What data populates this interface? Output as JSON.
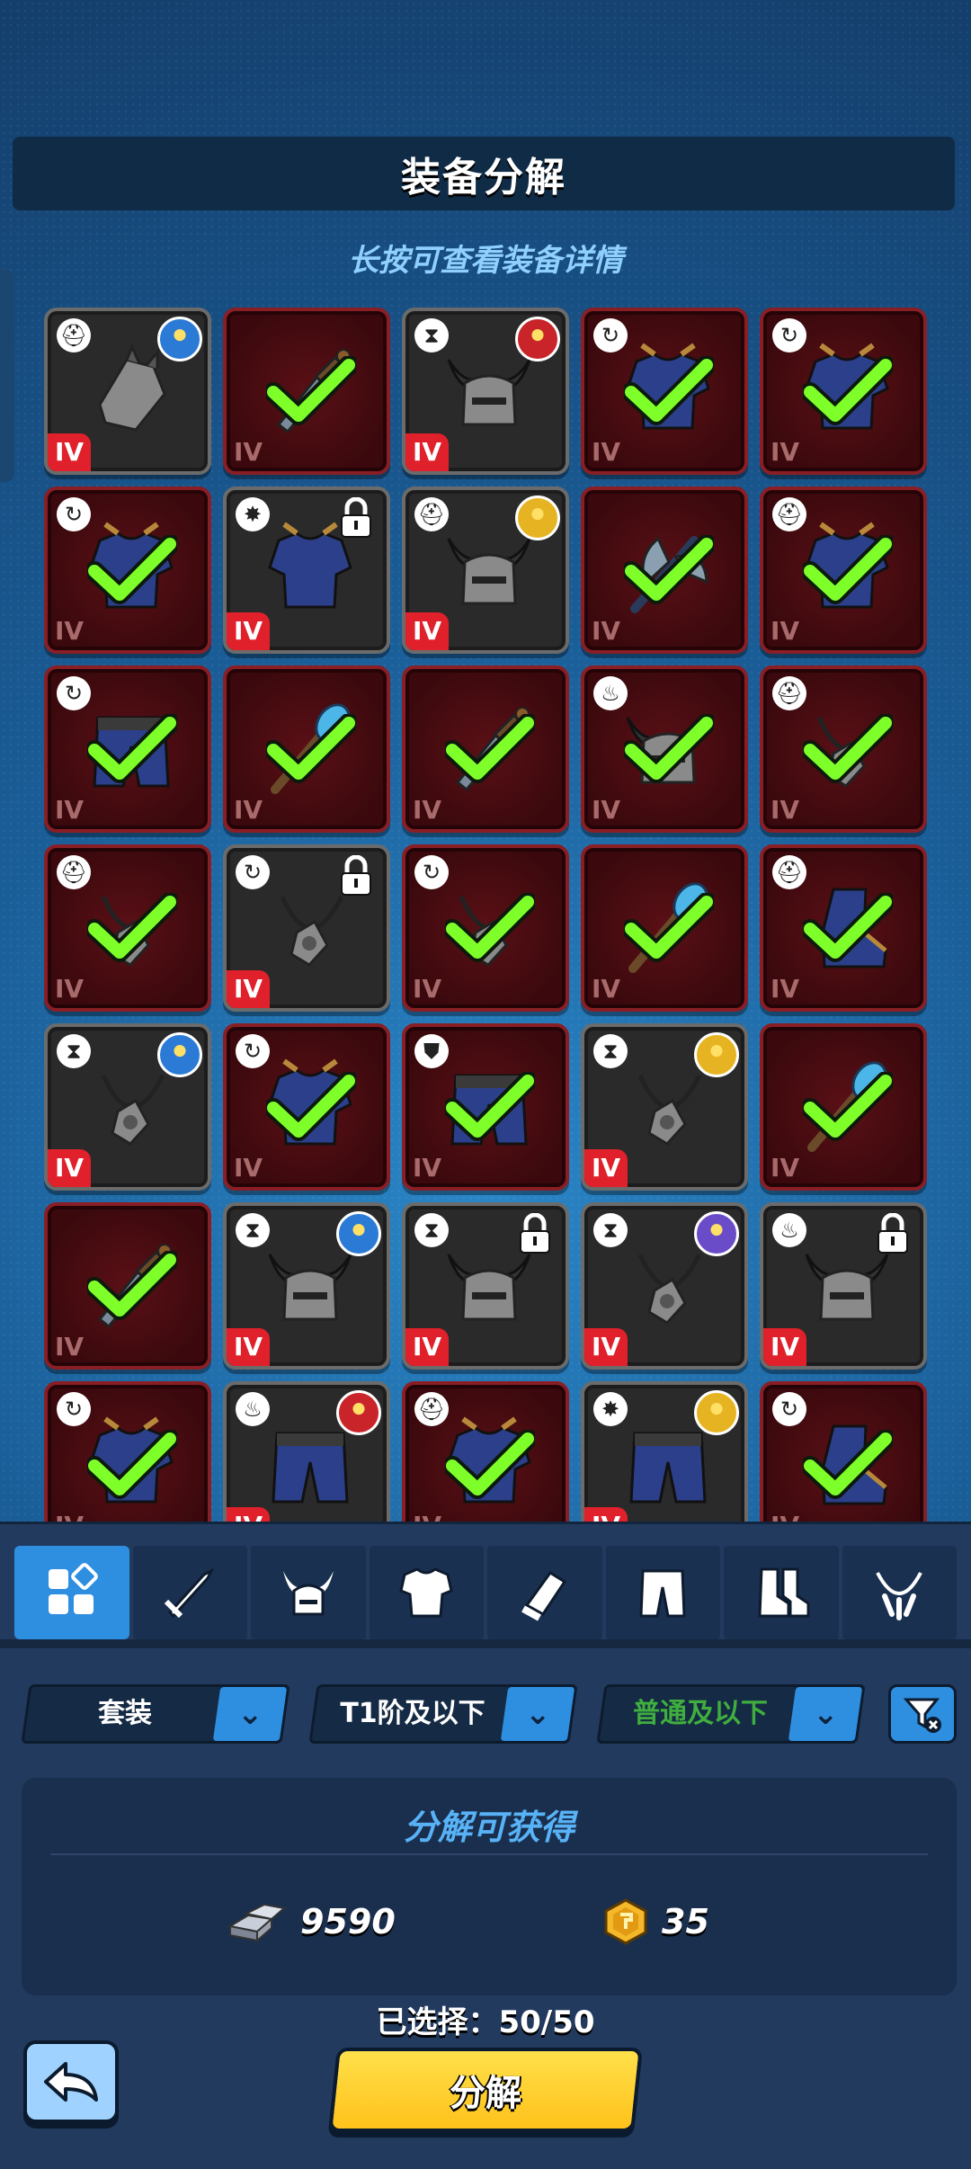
{
  "header": {
    "title": "装备分解",
    "hint": "长按可查看装备详情"
  },
  "colors": {
    "accent": "#2e8fe0",
    "selected_bg": "#3b090d",
    "check": "#7fff2a",
    "tier_red": "#e0202a",
    "button_yellow": "#ffd02a"
  },
  "grid": {
    "items": [
      {
        "item": "gauntlet",
        "set": "helmet-mark",
        "selected": false,
        "locked": false,
        "hero": "blue-hero-portrait",
        "tier": "IV"
      },
      {
        "item": "dagger",
        "set": "",
        "selected": true,
        "locked": false,
        "hero": "",
        "tier": "IV"
      },
      {
        "item": "horned-helmet",
        "set": "hourglass",
        "selected": false,
        "locked": false,
        "hero": "red-hero-portrait",
        "tier": "IV"
      },
      {
        "item": "chest-armor",
        "set": "cycle",
        "selected": true,
        "locked": false,
        "hero": "",
        "tier": "IV"
      },
      {
        "item": "chest-armor",
        "set": "cycle",
        "selected": true,
        "locked": false,
        "hero": "",
        "tier": "IV"
      },
      {
        "item": "chest-armor",
        "set": "cycle",
        "selected": true,
        "locked": false,
        "hero": "",
        "tier": "IV"
      },
      {
        "item": "chest-armor",
        "set": "star-burst",
        "selected": false,
        "locked": true,
        "hero": "",
        "tier": "IV"
      },
      {
        "item": "horned-helmet",
        "set": "helmet-mark",
        "selected": false,
        "locked": false,
        "hero": "gold-hero-portrait",
        "tier": "IV"
      },
      {
        "item": "axe",
        "set": "",
        "selected": true,
        "locked": false,
        "hero": "",
        "tier": "IV"
      },
      {
        "item": "chest-armor",
        "set": "helmet-mark",
        "selected": true,
        "locked": false,
        "hero": "",
        "tier": "IV"
      },
      {
        "item": "leg-armor",
        "set": "cycle",
        "selected": true,
        "locked": false,
        "hero": "",
        "tier": "IV"
      },
      {
        "item": "staff",
        "set": "",
        "selected": true,
        "locked": false,
        "hero": "",
        "tier": "IV"
      },
      {
        "item": "dagger",
        "set": "",
        "selected": true,
        "locked": false,
        "hero": "",
        "tier": "IV"
      },
      {
        "item": "horned-helmet",
        "set": "flame",
        "selected": true,
        "locked": false,
        "hero": "",
        "tier": "IV"
      },
      {
        "item": "amulet",
        "set": "helmet-mark",
        "selected": true,
        "locked": false,
        "hero": "",
        "tier": "IV"
      },
      {
        "item": "amulet",
        "set": "helmet-mark",
        "selected": true,
        "locked": false,
        "hero": "",
        "tier": "IV"
      },
      {
        "item": "amulet",
        "set": "cycle",
        "selected": false,
        "locked": true,
        "hero": "",
        "tier": "IV"
      },
      {
        "item": "amulet",
        "set": "cycle",
        "selected": true,
        "locked": false,
        "hero": "",
        "tier": "IV"
      },
      {
        "item": "staff",
        "set": "",
        "selected": true,
        "locked": false,
        "hero": "",
        "tier": "IV"
      },
      {
        "item": "boots",
        "set": "helmet-mark",
        "selected": true,
        "locked": false,
        "hero": "",
        "tier": "IV"
      },
      {
        "item": "amulet",
        "set": "hourglass",
        "selected": false,
        "locked": false,
        "hero": "blue-hero-portrait",
        "tier": "IV"
      },
      {
        "item": "chest-armor",
        "set": "cycle",
        "selected": true,
        "locked": false,
        "hero": "",
        "tier": "IV"
      },
      {
        "item": "leg-armor",
        "set": "shield",
        "selected": true,
        "locked": false,
        "hero": "",
        "tier": "IV"
      },
      {
        "item": "amulet",
        "set": "hourglass",
        "selected": false,
        "locked": false,
        "hero": "gold-hero-portrait",
        "tier": "IV"
      },
      {
        "item": "staff",
        "set": "",
        "selected": true,
        "locked": false,
        "hero": "",
        "tier": "IV"
      },
      {
        "item": "dagger",
        "set": "",
        "selected": true,
        "locked": false,
        "hero": "",
        "tier": "IV"
      },
      {
        "item": "horned-helmet",
        "set": "hourglass",
        "selected": false,
        "locked": false,
        "hero": "blue-hero-portrait",
        "tier": "IV"
      },
      {
        "item": "horned-helmet",
        "set": "hourglass",
        "selected": false,
        "locked": true,
        "hero": "",
        "tier": "IV"
      },
      {
        "item": "amulet",
        "set": "hourglass",
        "selected": false,
        "locked": false,
        "hero": "purple-hero-portrait",
        "tier": "IV"
      },
      {
        "item": "horned-helmet",
        "set": "flame",
        "selected": false,
        "locked": true,
        "hero": "",
        "tier": "IV"
      },
      {
        "item": "chest-armor",
        "set": "cycle",
        "selected": true,
        "locked": false,
        "hero": "",
        "tier": "IV"
      },
      {
        "item": "leg-armor",
        "set": "flame",
        "selected": false,
        "locked": false,
        "hero": "red-hero-portrait",
        "tier": "IV"
      },
      {
        "item": "chest-armor",
        "set": "helmet-mark",
        "selected": true,
        "locked": false,
        "hero": "",
        "tier": "IV"
      },
      {
        "item": "leg-armor",
        "set": "star-burst",
        "selected": false,
        "locked": false,
        "hero": "gold-hero-portrait",
        "tier": "IV"
      },
      {
        "item": "boots",
        "set": "cycle",
        "selected": true,
        "locked": false,
        "hero": "",
        "tier": "IV"
      }
    ]
  },
  "category_tabs": [
    {
      "icon": "grid-all-icon",
      "active": true
    },
    {
      "icon": "sword-icon",
      "active": false
    },
    {
      "icon": "helmet-icon",
      "active": false
    },
    {
      "icon": "chest-icon",
      "active": false
    },
    {
      "icon": "bracer-icon",
      "active": false
    },
    {
      "icon": "pants-icon",
      "active": false
    },
    {
      "icon": "boots-icon",
      "active": false
    },
    {
      "icon": "amulet-icon",
      "active": false
    }
  ],
  "filters": {
    "set": {
      "label": "套装"
    },
    "tier": {
      "label": "T1阶及以下"
    },
    "rarity": {
      "label": "普通及以下",
      "color": "#3fae3f"
    }
  },
  "yield": {
    "title": "分解可获得",
    "iron": {
      "value": "9590"
    },
    "gold": {
      "value": "35"
    }
  },
  "selection": {
    "text": "已选择：50/50"
  },
  "buttons": {
    "decompose": "分解"
  }
}
